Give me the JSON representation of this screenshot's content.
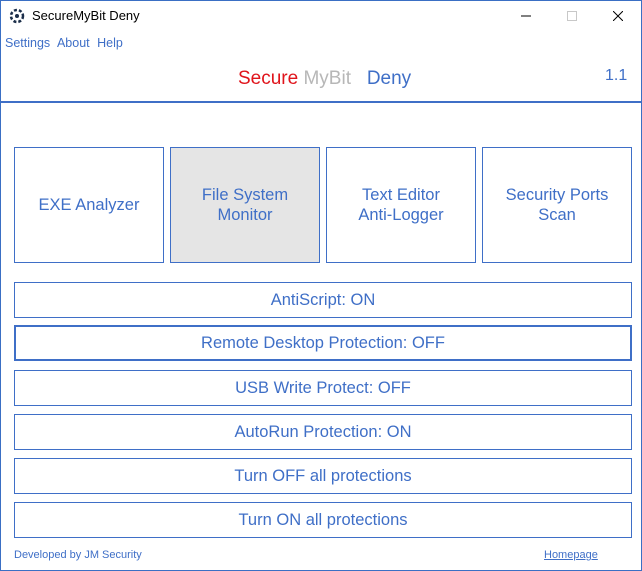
{
  "window": {
    "title": "SecureMyBit Deny"
  },
  "menu": {
    "items": [
      "Settings",
      "About",
      "Help"
    ]
  },
  "header": {
    "brand_secure": "Secure",
    "brand_mybit": "MyBit",
    "brand_deny": "Deny",
    "version": "1.1",
    "colors": {
      "secure": "#e0141b",
      "mybit": "#b7b7b7",
      "deny": "#3f6fc7"
    }
  },
  "tiles": [
    {
      "label": "EXE Analyzer",
      "active": false
    },
    {
      "label": "File System\nMonitor",
      "active": true
    },
    {
      "label": "Text Editor\nAnti-Logger",
      "active": false
    },
    {
      "label": "Security Ports\nScan",
      "active": false
    }
  ],
  "buttons": [
    "AntiScript: ON",
    "Remote Desktop Protection: OFF",
    "USB Write Protect: OFF",
    "AutoRun Protection: ON",
    "Turn OFF all protections",
    "Turn ON all protections"
  ],
  "footer": {
    "credit": "Developed by JM Security",
    "homepage": "Homepage"
  },
  "accent": "#3f6fc7"
}
